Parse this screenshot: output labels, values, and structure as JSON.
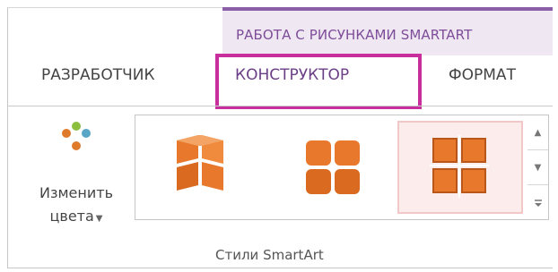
{
  "ribbon": {
    "context_group": "РАБОТА С РИСУНКАМИ SMARTART",
    "tabs": [
      {
        "label": "РАЗРАБОТЧИК"
      },
      {
        "label": "КОНСТРУКТОР"
      },
      {
        "label": "ФОРМАТ"
      }
    ],
    "highlighted_tab": "КОНСТРУКТОР",
    "highlight_color": "#c92f9c",
    "context_color": "#8b5fa7"
  },
  "change_colors": {
    "label_line1": "Изменить",
    "label_line2": "цвета",
    "dropdown_icon": "caret-down-icon",
    "dot_colors": [
      "#e07a2b",
      "#5aa6c7",
      "#8cbf3f",
      "#e07a2b"
    ]
  },
  "gallery": {
    "group_label": "Стили SmartArt",
    "items": [
      {
        "name": "smartart-style-1",
        "icon": "3d-matrix-icon"
      },
      {
        "name": "smartart-style-2",
        "icon": "3d-matrix-icon"
      },
      {
        "name": "smartart-style-3",
        "icon": "3d-matrix-icon",
        "selected": true
      }
    ],
    "accent_color": "#e8782b"
  }
}
